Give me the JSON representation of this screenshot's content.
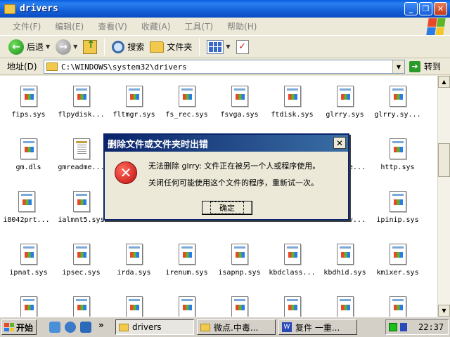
{
  "window": {
    "title": "drivers",
    "buttons": {
      "minimize": "_",
      "restore": "❐",
      "close": "✕"
    }
  },
  "menu": [
    "文件(F)",
    "编辑(E)",
    "查看(V)",
    "收藏(A)",
    "工具(T)",
    "帮助(H)"
  ],
  "toolbar": {
    "back_label": "后退",
    "back_symbol": "←",
    "forward_symbol": "→",
    "search_label": "搜索",
    "folders_label": "文件夹",
    "check_symbol": "✓",
    "dropdown_symbol": "▼"
  },
  "address": {
    "label": "地址(D)",
    "value": "C:\\WINDOWS\\system32\\drivers",
    "go_label": "转到",
    "go_symbol": "➔"
  },
  "files": [
    "fips.sys",
    "flpydisk...",
    "fltmgr.sys",
    "fs_rec.sys",
    "fsvga.sys",
    "ftdisk.sys",
    "glrry.sys",
    "glrry.sy...",
    "gm.dls",
    "gmreadme...",
    "",
    "",
    "",
    "",
    "e...",
    "http.sys",
    "i8042prt...",
    "ialmnt5.sys",
    "",
    "",
    "",
    "",
    "v...",
    "ipinip.sys",
    "ipnat.sys",
    "ipsec.sys",
    "irda.sys",
    "irenum.sys",
    "isapnp.sys",
    "kbdclass...",
    "kbdhid.sys",
    "kmixer.sys"
  ],
  "scrollbar": {
    "up": "▲",
    "down": "▼"
  },
  "dialog": {
    "title": "删除文件或文件夹时出错",
    "close_symbol": "✕",
    "error_symbol": "✕",
    "message1": "无法删除 glrry: 文件正在被另一个人或程序使用。",
    "message2": "关闭任何可能使用这个文件的程序，重新试一次。",
    "ok_label": "确定"
  },
  "taskbar": {
    "start_label": "开始",
    "more_symbol": "»",
    "tasks": [
      {
        "label": "drivers"
      },
      {
        "label": "微点.中毒..."
      },
      {
        "label": "复件 一重..."
      }
    ],
    "word_icon_symbol": "W",
    "clock": "22:37"
  }
}
